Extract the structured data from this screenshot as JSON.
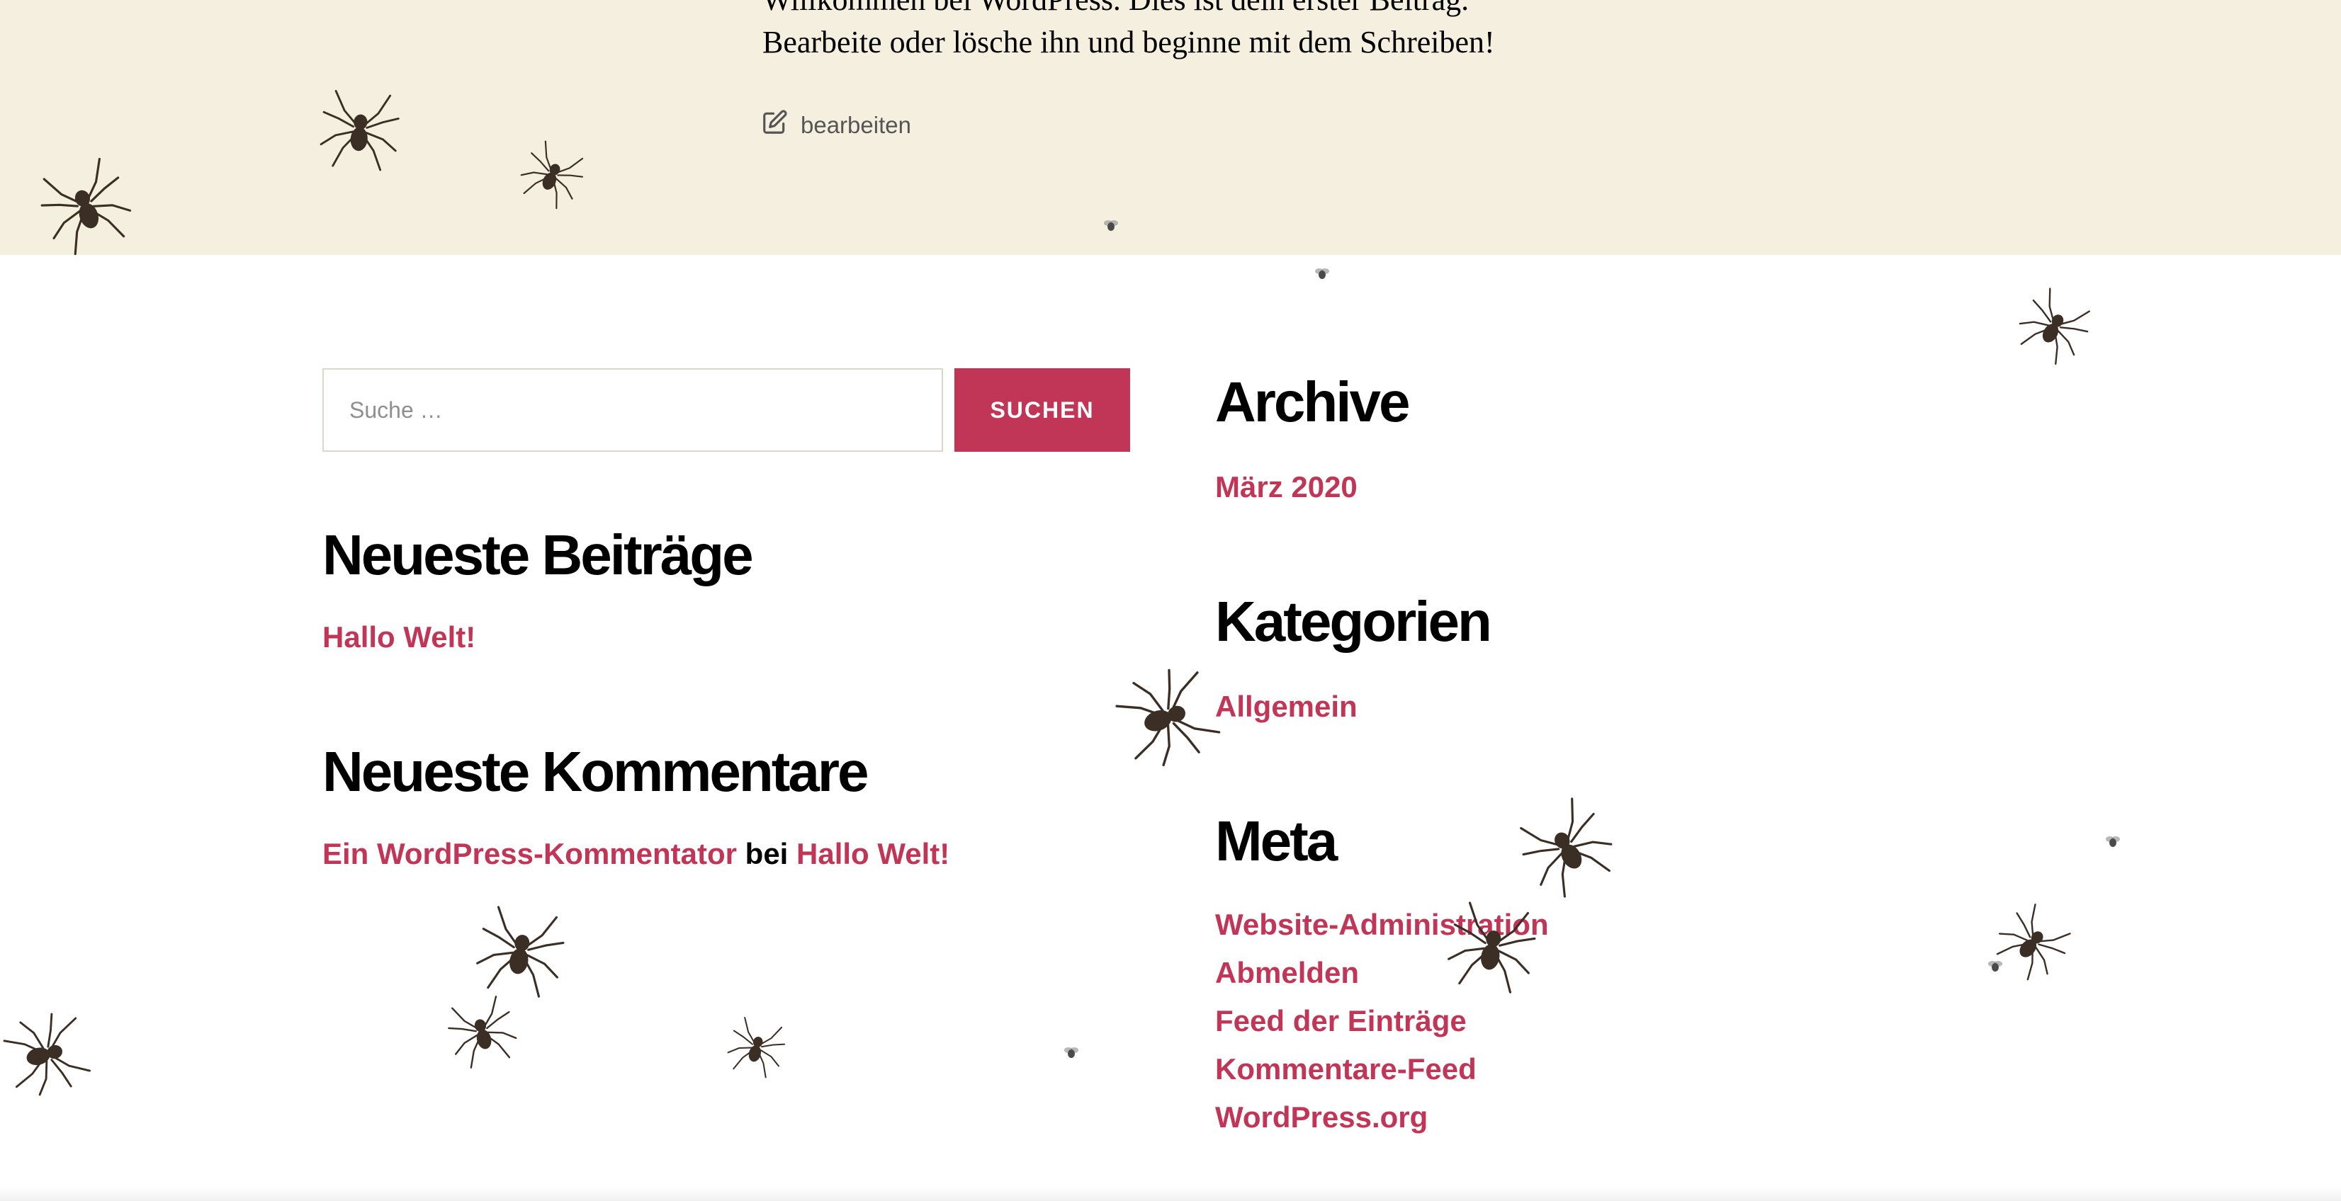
{
  "post": {
    "line1": "Willkommen bei WordPress. Dies ist dein erster Beitrag.",
    "line2": "Bearbeite oder lösche ihn und beginne mit dem Schreiben!",
    "edit_label": "bearbeiten"
  },
  "search": {
    "placeholder": "Suche …",
    "button_label": "SUCHEN"
  },
  "recent_posts": {
    "title": "Neueste Beiträge",
    "items": [
      "Hallo Welt!"
    ]
  },
  "recent_comments": {
    "title": "Neueste Kommentare",
    "author": "Ein WordPress-Kommentator",
    "connector": "bei",
    "post": "Hallo Welt!"
  },
  "archive": {
    "title": "Archive",
    "items": [
      "März 2020"
    ]
  },
  "categories": {
    "title": "Kategorien",
    "items": [
      "Allgemein"
    ]
  },
  "meta": {
    "title": "Meta",
    "items": [
      "Website-Administration",
      "Abmelden",
      "Feed der Einträge",
      "Kommentare-Feed",
      "WordPress.org"
    ]
  },
  "colors": {
    "accent": "#c13656",
    "band": "#f5efe0",
    "spider": "#3b2e24"
  },
  "icons": {
    "edit": "edit-pencil-icon",
    "spider": "spider-icon",
    "fly": "fly-icon"
  }
}
